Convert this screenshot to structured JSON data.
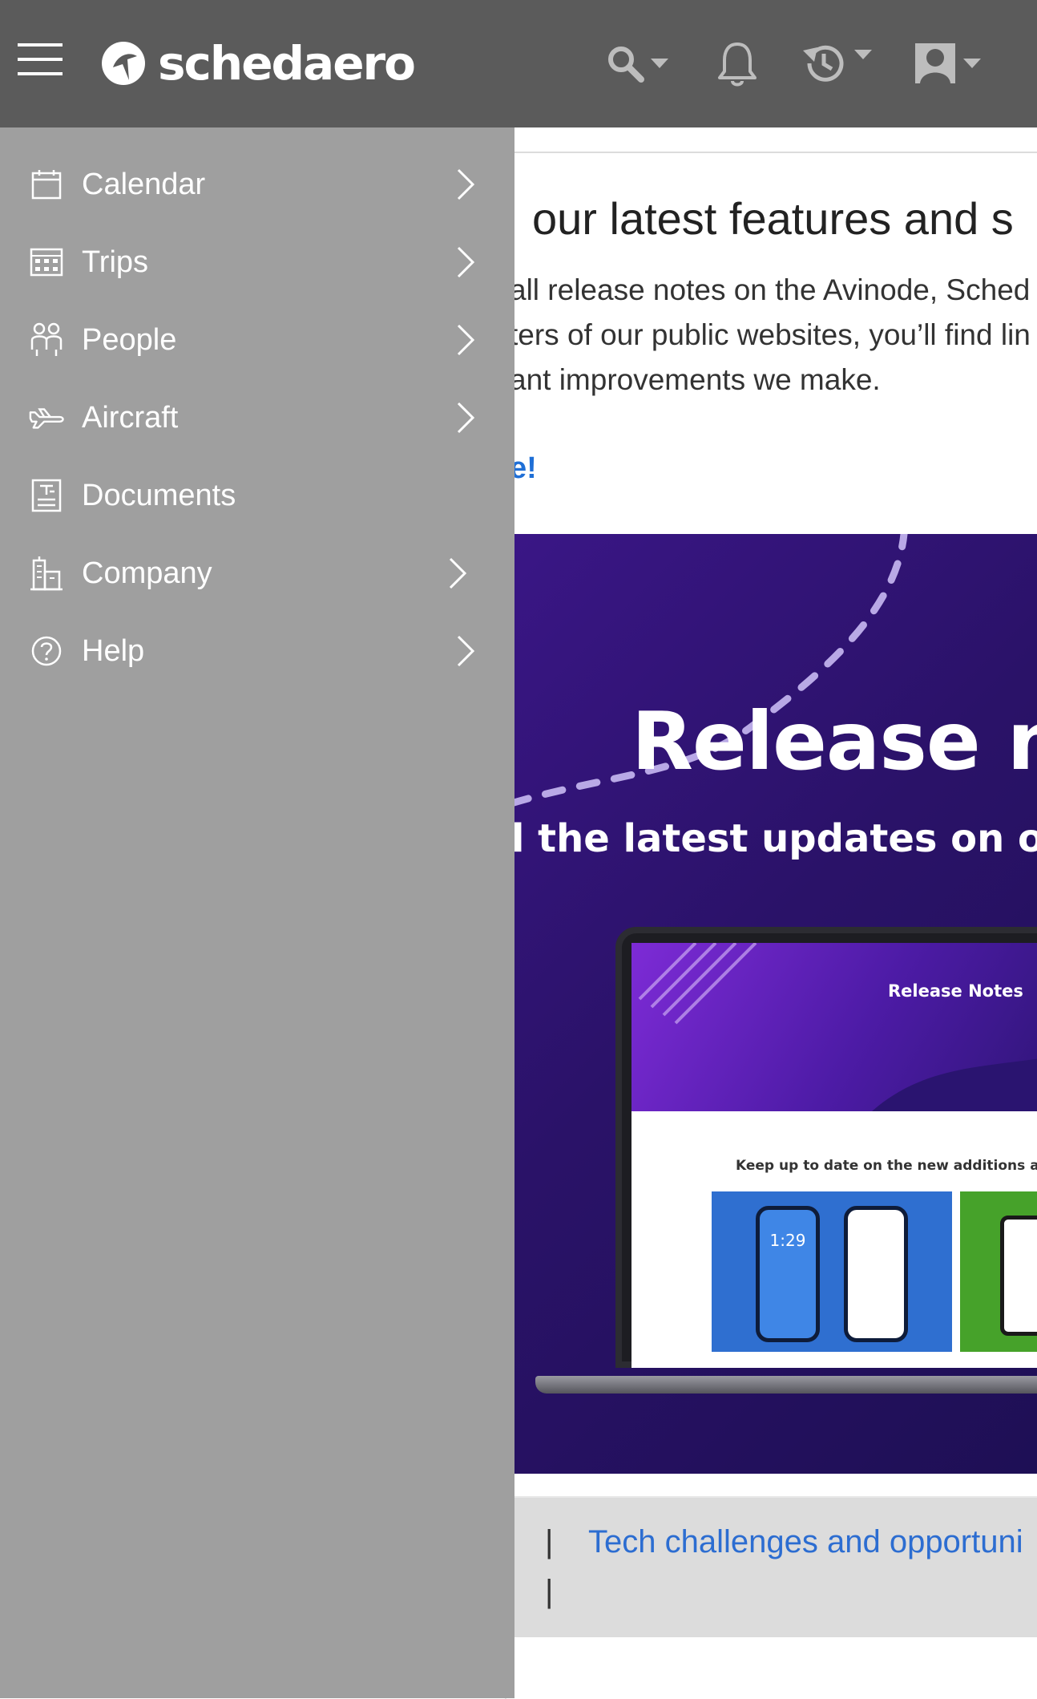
{
  "header": {
    "logo_text": "schedaero"
  },
  "colors": {
    "header_bg": "#5b5b5b",
    "drawer_bg": "#9f9f9f",
    "link_blue": "#1f6fd6",
    "banner_purple": "#2a1268"
  },
  "sidebar": {
    "items": [
      {
        "label": "Calendar",
        "icon": "calendar-icon",
        "has_submenu": true
      },
      {
        "label": "Trips",
        "icon": "trips-icon",
        "has_submenu": true
      },
      {
        "label": "People",
        "icon": "people-icon",
        "has_submenu": true
      },
      {
        "label": "Aircraft",
        "icon": "aircraft-icon",
        "has_submenu": true
      },
      {
        "label": "Documents",
        "icon": "documents-icon",
        "has_submenu": false
      },
      {
        "label": "Company",
        "icon": "company-icon",
        "has_submenu": true
      },
      {
        "label": "Help",
        "icon": "help-icon",
        "has_submenu": true
      }
    ]
  },
  "article": {
    "title": "our latest features and s",
    "lines": [
      "all release notes on the Avinode, Sched",
      "ters of our public websites, you’ll find lin",
      "ant improvements we make."
    ],
    "link": "e!"
  },
  "banner": {
    "title": "Release n",
    "subtitle": "l the latest updates on ou",
    "screen_title": "Release Notes",
    "screen_subtitle": "Keep up to date on the new additions and t",
    "phone_time": "1:29"
  },
  "footer": {
    "separator": "|",
    "link": "Tech challenges and opportuni"
  }
}
